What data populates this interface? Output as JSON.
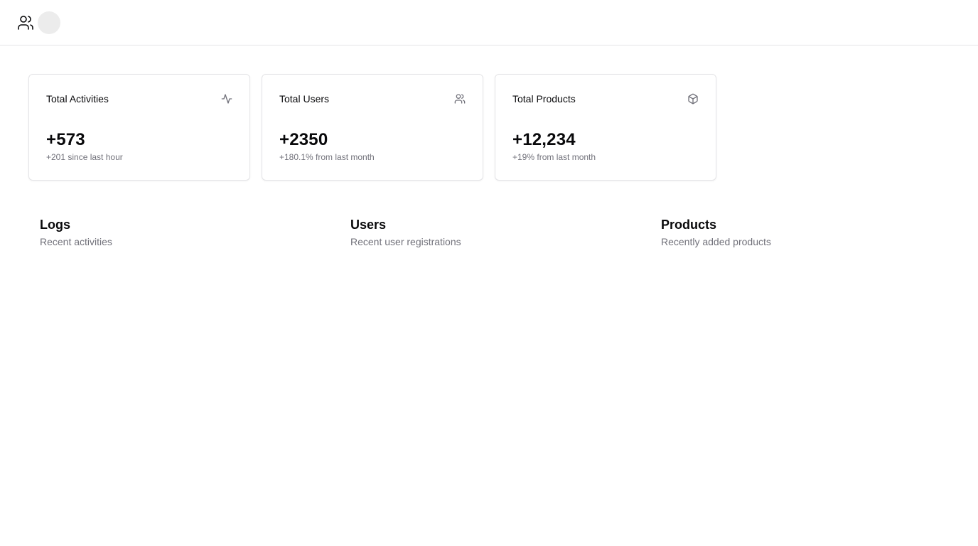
{
  "header": {
    "app_icon": "users-icon",
    "avatar_icon": "avatar"
  },
  "stats": [
    {
      "title": "Total Activities",
      "icon": "activity-icon",
      "value": "+573",
      "subtitle": "+201 since last hour"
    },
    {
      "title": "Total Users",
      "icon": "users-icon",
      "value": "+2350",
      "subtitle": "+180.1% from last month"
    },
    {
      "title": "Total Products",
      "icon": "package-icon",
      "value": "+12,234",
      "subtitle": "+19% from last month"
    }
  ],
  "sections": [
    {
      "title": "Logs",
      "description": "Recent activities"
    },
    {
      "title": "Users",
      "description": "Recent user registrations"
    },
    {
      "title": "Products",
      "description": "Recently added products"
    }
  ],
  "colors": {
    "text": "#09090b",
    "muted": "#71717a",
    "border": "#e4e4e7",
    "avatar_bg": "#ececec"
  }
}
